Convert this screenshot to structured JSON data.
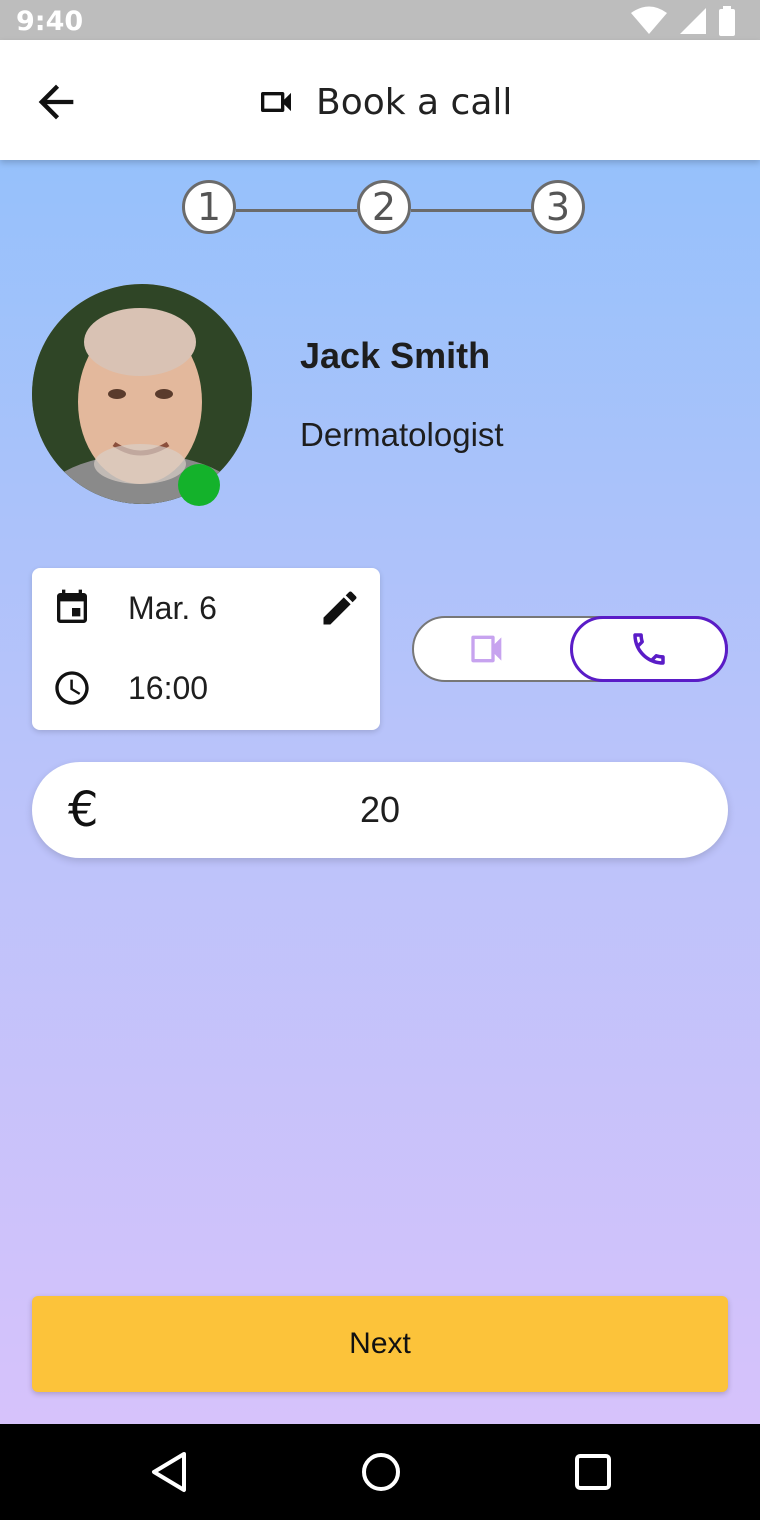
{
  "status_bar": {
    "time": "9:40"
  },
  "app_bar": {
    "title": "Book a call"
  },
  "stepper": {
    "steps": [
      "1",
      "2",
      "3"
    ]
  },
  "doctor": {
    "name": "Jack Smith",
    "specialty": "Dermatologist",
    "status_color": "#14b22b"
  },
  "appointment": {
    "date": "Mar. 6",
    "time": "16:00"
  },
  "call_type": {
    "options": [
      "video",
      "audio"
    ],
    "selected": "audio"
  },
  "price": {
    "currency_symbol": "€",
    "amount": "20"
  },
  "actions": {
    "next_label": "Next"
  },
  "colors": {
    "accent": "#5a1cc7",
    "button": "#fcc33a",
    "online": "#14b22b"
  }
}
